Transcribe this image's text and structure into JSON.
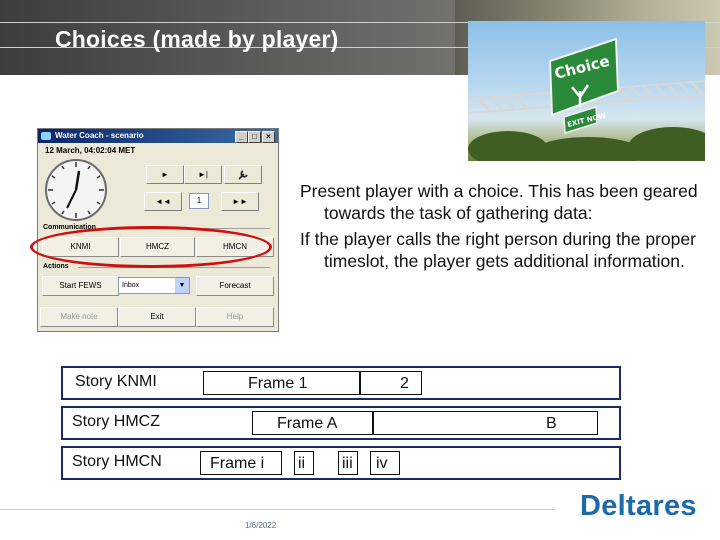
{
  "slide": {
    "title": "Choices (made by player)"
  },
  "photo": {
    "sign_main": "Choice",
    "sign_exit": "EXIT NOW"
  },
  "app_window": {
    "title": "Water Coach - scenario",
    "datetime": "12 March, 04:02:04 MET",
    "window_controls": [
      "_",
      "□",
      "×"
    ],
    "playback": {
      "play": "►",
      "step": "►|",
      "settings_icon": "wrench-icon",
      "rewind": "◄◄",
      "counter": "1",
      "forward": "►►"
    },
    "communication": {
      "label": "Communication",
      "buttons": [
        "KNMI",
        "HMCZ",
        "HMCN"
      ]
    },
    "actions": {
      "label": "Actions",
      "start_button": "Start FEWS",
      "inbox_value": "Inbox",
      "forecast_button": "Forecast"
    },
    "bottom_buttons": {
      "make_note": "Make note",
      "exit": "Exit",
      "help": "Help"
    }
  },
  "bullets": [
    "Present player with a choice. This has been geared towards the task of gathering data:",
    "If the player calls the right person during the proper timeslot, the player gets additional information."
  ],
  "stories": [
    {
      "label": "Story KNMI",
      "frames": [
        "Frame 1",
        "2"
      ]
    },
    {
      "label": "Story HMCZ",
      "frames": [
        "Frame A",
        "B"
      ]
    },
    {
      "label": "Story HMCN",
      "frames": [
        "Frame i",
        "ii",
        "iii",
        "iv"
      ]
    }
  ],
  "footer": {
    "date": "1/6/2022",
    "logo": "Deltares"
  },
  "colors": {
    "highlight_ellipse": "#d01010",
    "track_border": "#1a2a6c",
    "logo": "#1d6aa8"
  }
}
